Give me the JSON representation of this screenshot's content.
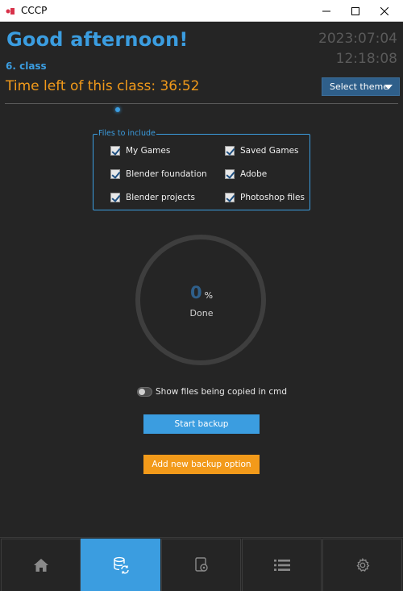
{
  "window": {
    "title": "CCCP",
    "logo_text": "CCCP"
  },
  "header": {
    "greeting": "Good afternoon!",
    "class_name": "6. class",
    "time_left": "Time left of this class: 36:52",
    "date": "2023:07:04",
    "time": "12:18:08",
    "theme_button": "Select theme"
  },
  "files_group": {
    "legend": "Files to include",
    "items": [
      {
        "label": "My Games",
        "checked": true
      },
      {
        "label": "Saved Games",
        "checked": true
      },
      {
        "label": "Blender foundation",
        "checked": true
      },
      {
        "label": "Adobe",
        "checked": true
      },
      {
        "label": "Blender projects",
        "checked": true
      },
      {
        "label": "Photoshop files",
        "checked": true
      }
    ]
  },
  "progress": {
    "value": "0",
    "unit": "%",
    "label": "Done",
    "fraction": 0
  },
  "options": {
    "show_cmd_label": "Show files being copied in cmd",
    "show_cmd_on": false
  },
  "buttons": {
    "start": "Start backup",
    "add": "Add new backup option"
  },
  "nav": [
    {
      "icon": "home-icon",
      "active": false
    },
    {
      "icon": "database-sync-icon",
      "active": true
    },
    {
      "icon": "backup-device-icon",
      "active": false
    },
    {
      "icon": "list-icon",
      "active": false
    },
    {
      "icon": "settings-icon",
      "active": false
    }
  ],
  "colors": {
    "accent_blue": "#3b9de0",
    "accent_orange": "#f29a1a",
    "background": "#252525",
    "muted": "#5a5a5a"
  }
}
